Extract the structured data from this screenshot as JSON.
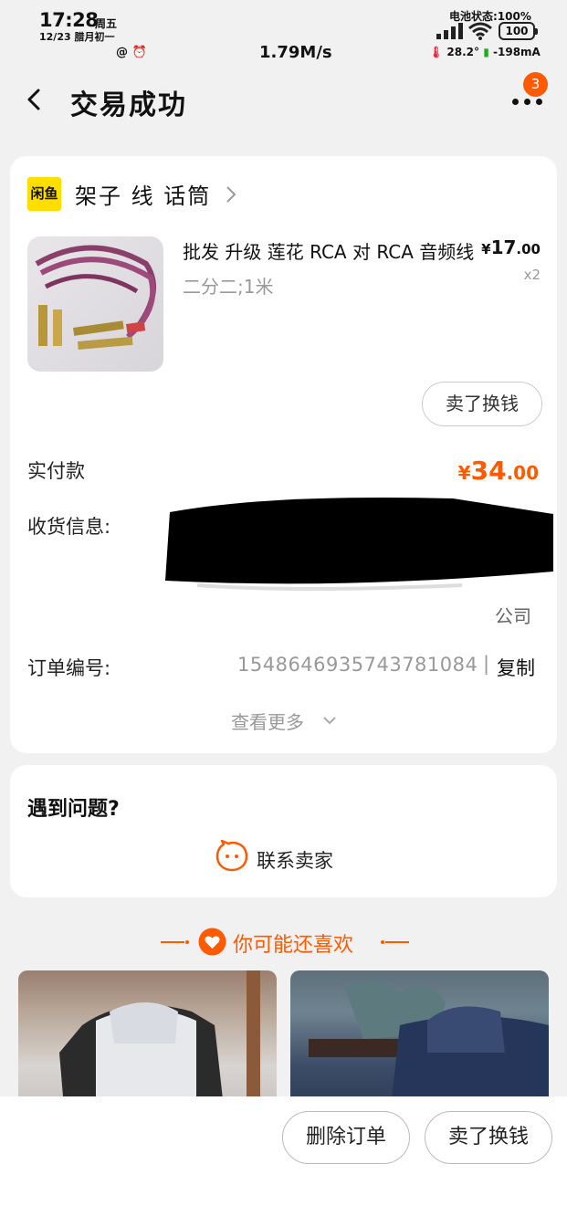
{
  "status_bar": {
    "time": "17:28",
    "weekday": "周五",
    "date": "12/23 腊月初一",
    "net_speed": "1.79M/s",
    "battery_label": "电池状态:100%",
    "battery_level": "100",
    "temperature": "28.2°",
    "current": "-198mA"
  },
  "nav": {
    "title": "交易成功",
    "badge": "3"
  },
  "shop": {
    "logo_text": "闲鱼",
    "name": "架子 线 话筒"
  },
  "product": {
    "title": "批发 升级 莲花 RCA 对 RCA 音频线",
    "spec": "二分二;1米",
    "price_currency": "¥",
    "price_int": "17",
    "price_dec": ".00",
    "quantity": "x2",
    "sell_button": "卖了换钱"
  },
  "order": {
    "paid_label": "实付款",
    "paid_currency": "¥",
    "paid_int": "34",
    "paid_dec": ".00",
    "address_label": "收货信息:",
    "address_tail": "公司",
    "order_no_label": "订单编号:",
    "order_no": "1548646935743781084",
    "order_sep": "|",
    "copy": "复制",
    "see_more": "查看更多"
  },
  "help": {
    "title": "遇到问题?",
    "contact": "联系卖家"
  },
  "recommend": {
    "title": "你可能还喜欢"
  },
  "bottom": {
    "delete_order": "删除订单",
    "sell": "卖了换钱"
  },
  "colors": {
    "accent": "#ff5a00",
    "logo_yellow": "#ffde00",
    "background": "#f1f1f1"
  }
}
